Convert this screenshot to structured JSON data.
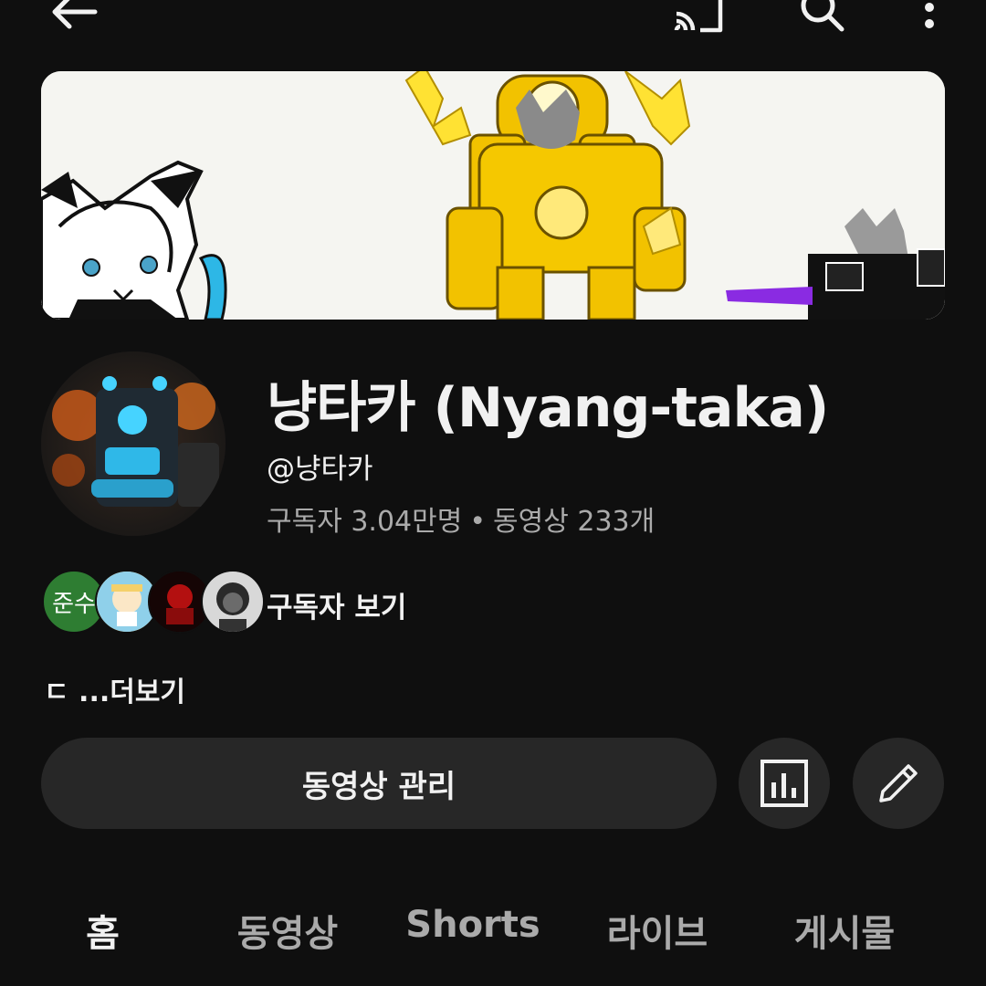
{
  "header": {
    "back_icon": "arrow-left-icon",
    "cast_icon": "cast-icon",
    "search_icon": "search-icon",
    "more_icon": "more-vertical-icon"
  },
  "channel": {
    "name": "냥타카 (Nyang-taka)",
    "handle": "@냥타카",
    "subscribers": "구독자 3.04만명",
    "separator": "•",
    "videos": "동영상 233개"
  },
  "subscribers_preview": {
    "first_avatar_text": "준수",
    "label": "구독자 보기"
  },
  "description": {
    "text": "ㄷ ...더보기"
  },
  "actions": {
    "manage_videos": "동영상 관리",
    "analytics_icon": "analytics-icon",
    "edit_icon": "pencil-icon"
  },
  "tabs": [
    {
      "label": "홈",
      "active": true
    },
    {
      "label": "동영상",
      "active": false
    },
    {
      "label": "Shorts",
      "active": false
    },
    {
      "label": "라이브",
      "active": false
    },
    {
      "label": "게시물",
      "active": false
    }
  ],
  "colors": {
    "background": "#0f0f0f",
    "button": "#272727",
    "text": "#f1f1f1",
    "muted": "#aaaaaa",
    "banner_accent": "#f2c200"
  }
}
